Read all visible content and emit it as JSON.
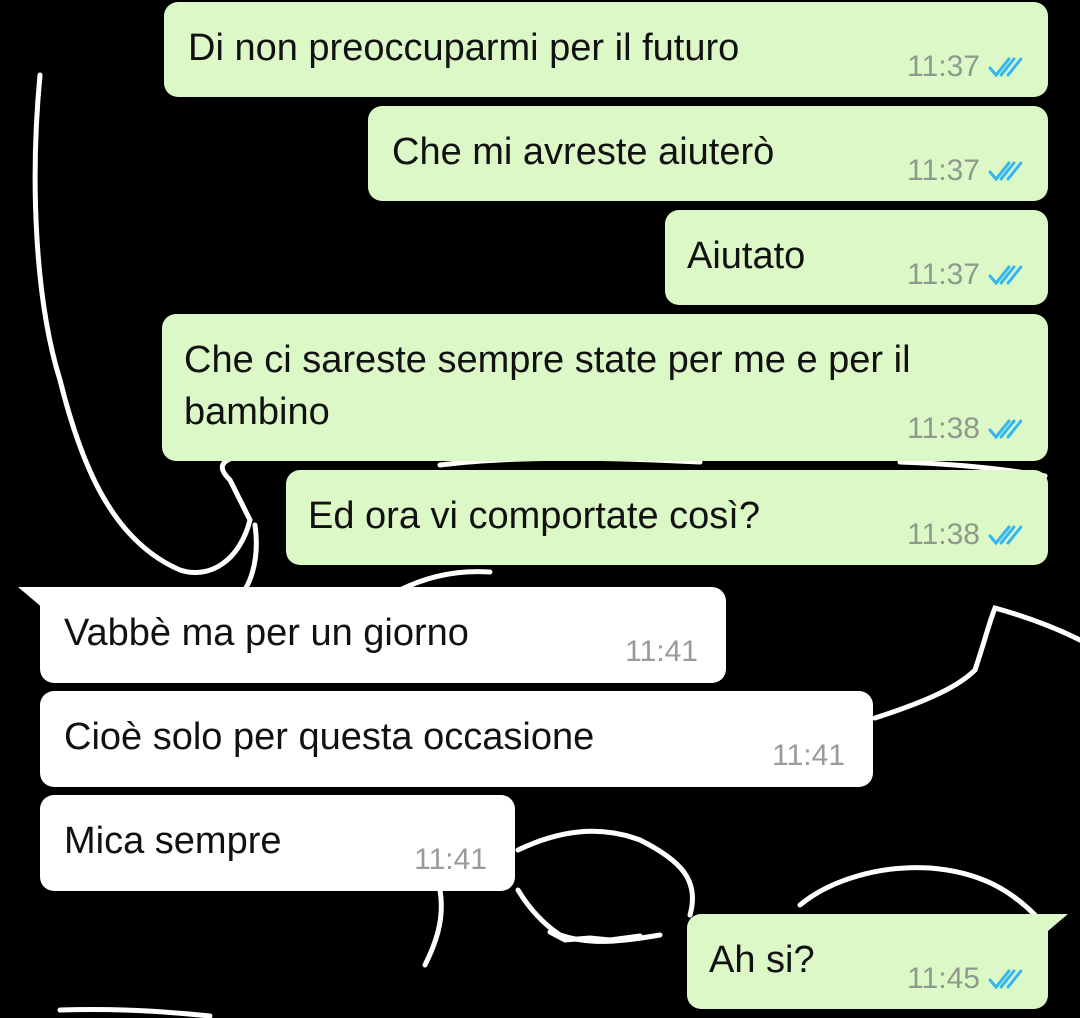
{
  "colors": {
    "outgoing_bubble": "#dcf8c6",
    "incoming_bubble": "#ffffff",
    "read_ticks": "#34b7f1",
    "wallpaper_background": "#000000",
    "wallpaper_drawing": "#ffffff"
  },
  "messages": [
    {
      "direction": "outgoing",
      "text": "Di non preoccuparmi per il futuro",
      "time": "11:37",
      "status": "read-double-check-icon"
    },
    {
      "direction": "outgoing",
      "text": "Che mi avreste aiuterò",
      "time": "11:37",
      "status": "read-double-check-icon"
    },
    {
      "direction": "outgoing",
      "text": "Aiutato",
      "time": "11:37",
      "status": "read-double-check-icon"
    },
    {
      "direction": "outgoing",
      "text_line1": "Che ci sareste sempre state per me e per il",
      "text_line2": "bambino",
      "time": "11:38",
      "status": "read-double-check-icon"
    },
    {
      "direction": "outgoing",
      "text": "Ed ora vi comportate così?",
      "time": "11:38",
      "status": "read-double-check-icon"
    },
    {
      "direction": "incoming",
      "text": "Vabbè ma per un giorno",
      "time": "11:41"
    },
    {
      "direction": "incoming",
      "text": "Cioè solo per questa occasione",
      "time": "11:41"
    },
    {
      "direction": "incoming",
      "text": "Mica sempre",
      "time": "11:41"
    },
    {
      "direction": "outgoing",
      "text": "Ah si?",
      "time": "11:45",
      "status": "read-double-check-icon"
    }
  ]
}
